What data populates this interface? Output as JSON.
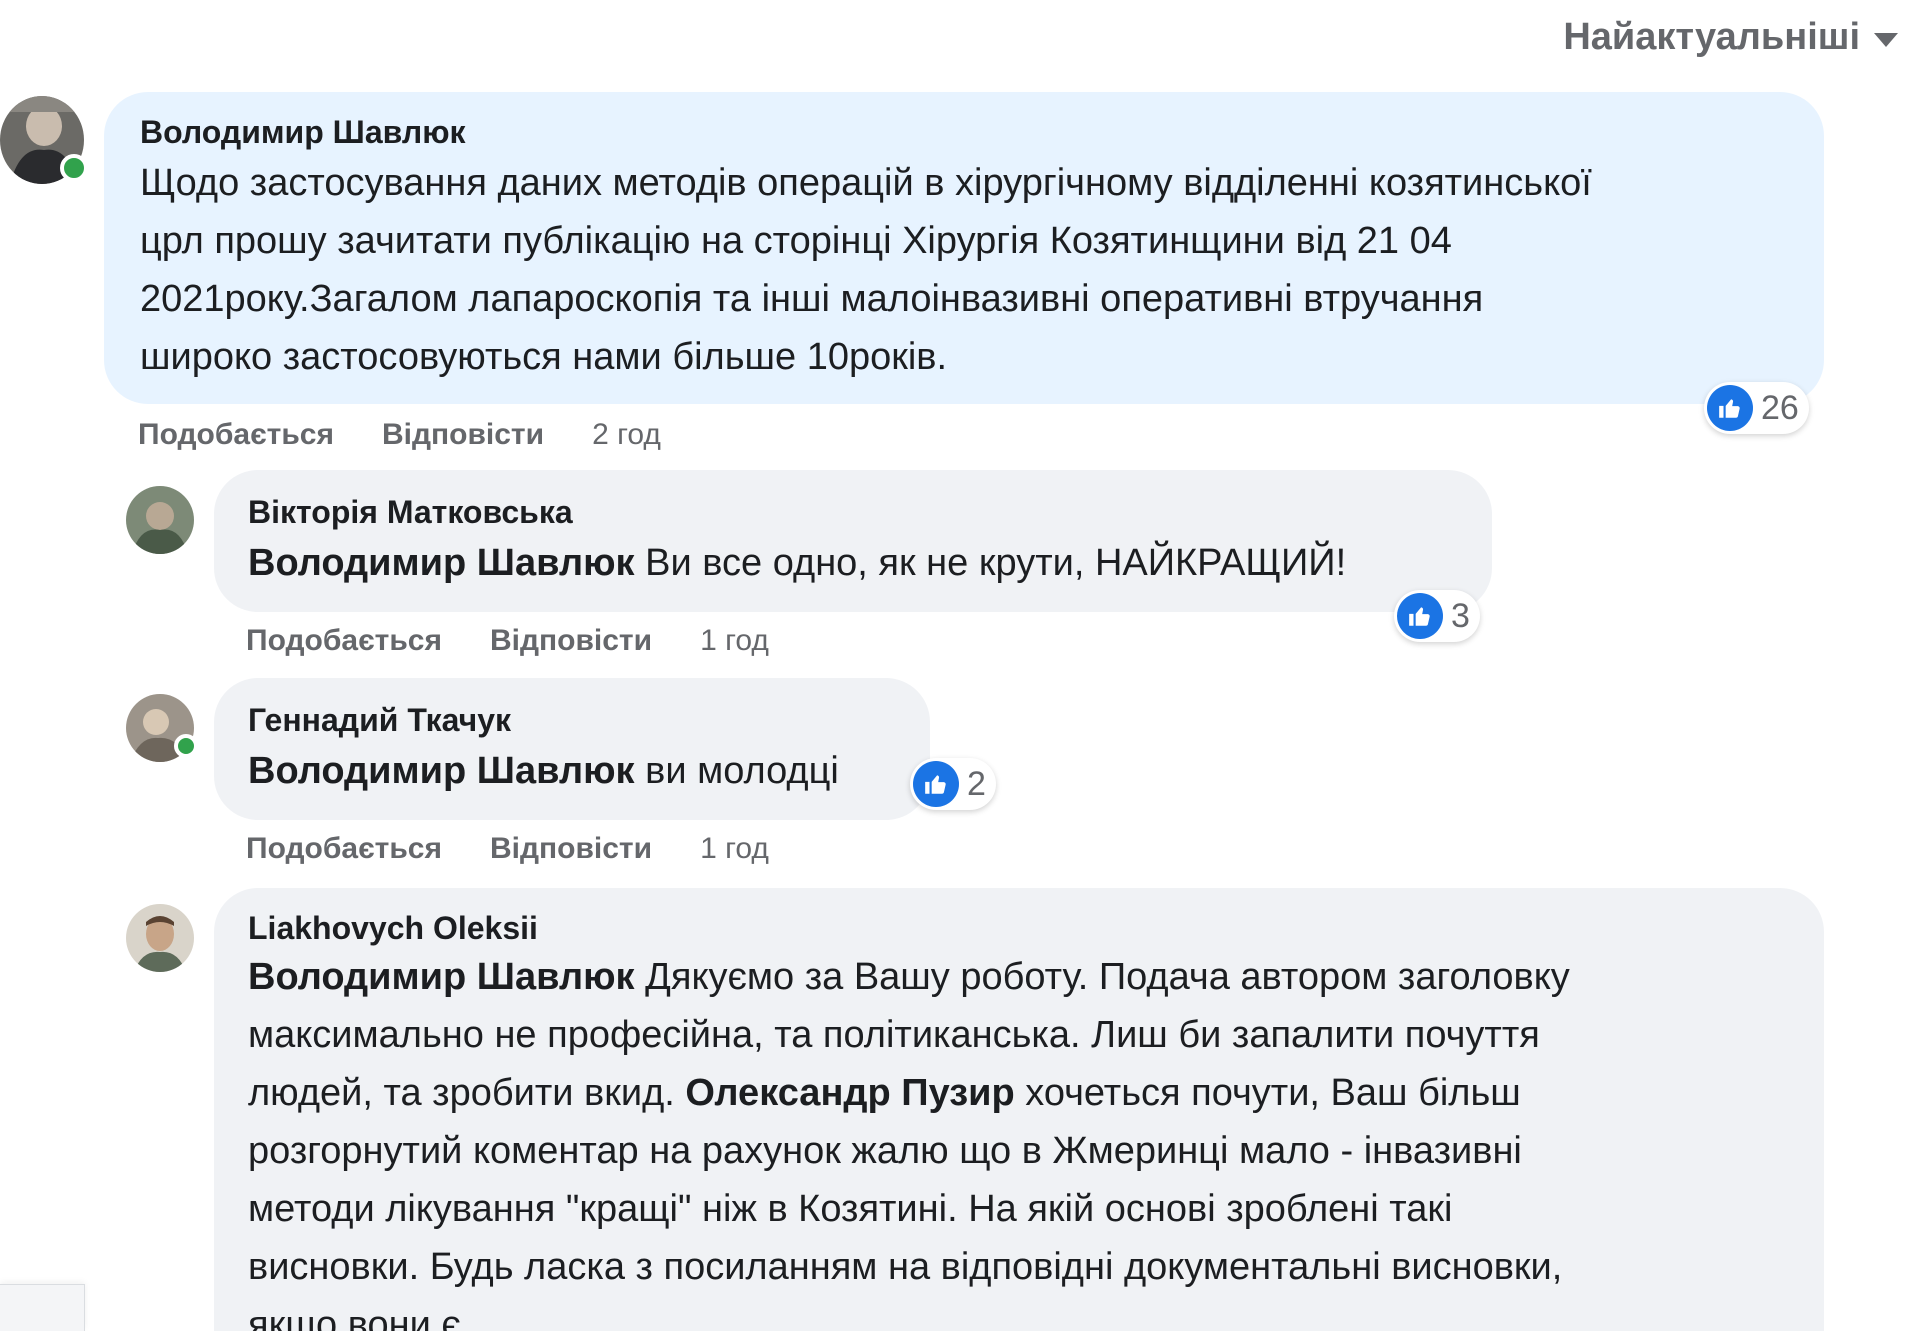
{
  "sort": {
    "label": "Найактуальніші"
  },
  "colors": {
    "like_blue": "#1b74e4",
    "online_green": "#31a24c",
    "bubble_highlight": "#e7f3ff",
    "bubble_gray": "#f0f2f5"
  },
  "comments": [
    {
      "author": "Володимир Шавлюк",
      "lines": [
        "Щодо застосування даних методів операцій в хірургічному відділенні козятинської",
        "црл прошу зачитати публікацію на сторінці Хірургія Козятинщини від 21 04",
        "2021року.Загалом лапароскопія та інші малоінвазивні оперативні втручання",
        "широко застосовуються нами більше 10років."
      ],
      "reactions": "26",
      "like_label": "Подобається",
      "reply_label": "Відповісти",
      "time": "2 год"
    },
    {
      "author": "Вікторія Матковська",
      "mention": "Володимир Шавлюк",
      "text": " Ви все одно, як не крути, НАЙКРАЩИЙ!",
      "reactions": "3",
      "like_label": "Подобається",
      "reply_label": "Відповісти",
      "time": "1 год"
    },
    {
      "author": "Геннадий Ткачук",
      "mention": "Володимир Шавлюк",
      "text": " ви молодці",
      "reactions": "2",
      "like_label": "Подобається",
      "reply_label": "Відповісти",
      "time": "1 год"
    },
    {
      "author": "Liakhovych Oleksii",
      "line1_mention": "Володимир Шавлюк",
      "line1_text": " Дякуємо за Вашу роботу. Подача автором заголовку",
      "line2": "максимально не професійна, та політиканська. Лиш би запалити почуття",
      "line3_text": "людей, та зробити вкид. ",
      "line3_mention": "Олександр Пузир",
      "line3_rest": " хочеться почути, Ваш більш",
      "line4": "розгорнутий коментар на рахунок жалю що в Жмеринці мало - інвазивні",
      "line5": "методи лікування \"кращі\" ніж в Козятині. На якій основі зроблені такі",
      "line6": "висновки. Будь ласка з посиланням на відповідні документальні висновки,",
      "line7": "якщо вони є"
    }
  ]
}
